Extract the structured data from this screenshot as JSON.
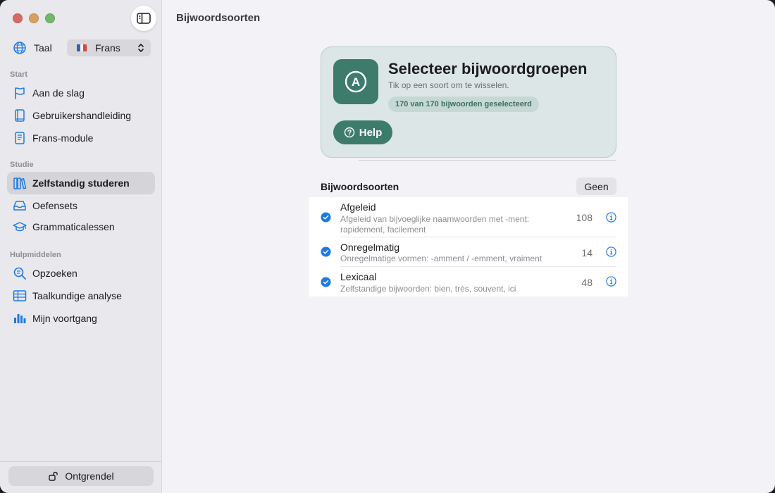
{
  "sidebar": {
    "language_label": "Taal",
    "language_value": "Frans",
    "sections": [
      {
        "label": "Start"
      },
      {
        "label": "Studie"
      },
      {
        "label": "Hulpmiddelen"
      }
    ],
    "items": [
      {
        "label": "Aan de slag",
        "icon": "flag-icon"
      },
      {
        "label": "Gebruikershandleiding",
        "icon": "book-icon"
      },
      {
        "label": "Frans-module",
        "icon": "document-icon"
      },
      {
        "label": "Zelfstandig studeren",
        "icon": "books-icon",
        "active": true
      },
      {
        "label": "Oefensets",
        "icon": "tray-icon"
      },
      {
        "label": "Grammaticalessen",
        "icon": "graduation-cap-icon"
      },
      {
        "label": "Opzoeken",
        "icon": "search-text-icon"
      },
      {
        "label": "Taalkundige analyse",
        "icon": "table-icon"
      },
      {
        "label": "Mijn voortgang",
        "icon": "bar-chart-icon"
      }
    ],
    "unlock_label": "Ontgrendel"
  },
  "main": {
    "title": "Bijwoordsoorten",
    "hero": {
      "title": "Selecteer bijwoordgroepen",
      "subtitle": "Tik op een soort om te wisselen.",
      "badge": "170 van 170 bijwoorden geselecteerd",
      "help_label": "Help",
      "icon_letter": "A"
    },
    "list": {
      "header": "Bijwoordsoorten",
      "none_label": "Geen",
      "rows": [
        {
          "title": "Afgeleid",
          "desc": "Afgeleid van bijvoeglijke naamwoorden met -ment: rapidement, facilement",
          "count": "108",
          "checked": true
        },
        {
          "title": "Onregelmatig",
          "desc": "Onregelmatige vormen: -amment / -emment, vraiment",
          "count": "14",
          "checked": true
        },
        {
          "title": "Lexicaal",
          "desc": "Zelfstandige bijwoorden: bien, très, souvent, ici",
          "count": "48",
          "checked": true
        }
      ]
    }
  },
  "colors": {
    "accent": "#1f7ae0",
    "brand_green": "#3d7c6a"
  }
}
